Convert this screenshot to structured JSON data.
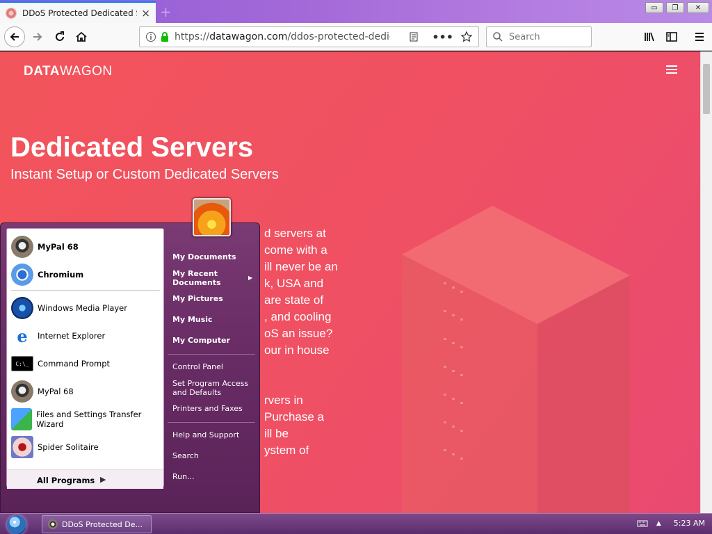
{
  "browser": {
    "tab_title": "DDoS Protected Dedicated Serve",
    "tab_close": "×",
    "new_tab": "+",
    "window_buttons": [
      "▭",
      "❐",
      "✕"
    ],
    "url_secure": "https://",
    "url_host": "datawagon.com",
    "url_path": "/ddos-protected-dedicated-s",
    "search_placeholder": "Search"
  },
  "page": {
    "logo_bold": "DATA",
    "logo_rest": "WAGON",
    "hero_title": "Dedicated Servers",
    "hero_subtitle": "Instant Setup or Custom Dedicated Servers",
    "paragraph1": [
      "d servers at",
      "come with a",
      "ill never be an",
      "k, USA and",
      "are state of",
      ", and cooling",
      "oS an issue?",
      "our in house"
    ],
    "paragraph2": [
      "rvers in",
      "Purchase a",
      "ill be",
      "ystem of"
    ]
  },
  "start_menu": {
    "pinned": [
      {
        "label": "MyPal 68",
        "icon": "raccoon-icon"
      },
      {
        "label": "Chromium",
        "icon": "chromium-icon"
      }
    ],
    "recent": [
      {
        "label": "Windows Media Player",
        "icon": "media-player-icon"
      },
      {
        "label": "Internet Explorer",
        "icon": "internet-explorer-icon"
      },
      {
        "label": "Command Prompt",
        "icon": "command-prompt-icon"
      },
      {
        "label": "MyPal 68",
        "icon": "raccoon-icon"
      },
      {
        "label": "Files and Settings Transfer Wizard",
        "icon": "transfer-wizard-icon"
      },
      {
        "label": "Spider Solitaire",
        "icon": "spider-icon"
      }
    ],
    "all_programs": "All Programs",
    "right": {
      "my_documents": "My Documents",
      "my_recent_1": "My Recent",
      "my_recent_2": "Documents",
      "my_pictures": "My Pictures",
      "my_music": "My Music",
      "my_computer": "My Computer",
      "control_panel": "Control Panel",
      "set_program_1": "Set Program Access",
      "set_program_2": "and Defaults",
      "printers": "Printers and Faxes",
      "help": "Help and Support",
      "search": "Search",
      "run": "Run..."
    }
  },
  "taskbar": {
    "task_label": "DDoS Protected De...",
    "time": "5:23 AM"
  }
}
